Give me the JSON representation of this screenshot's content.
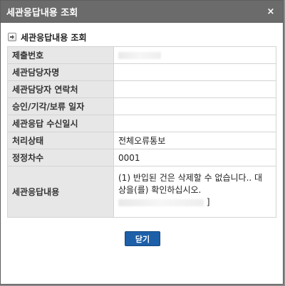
{
  "window": {
    "title": "세관응답내용 조회",
    "close_symbol": "×"
  },
  "section": {
    "title": "세관응답내용 조회",
    "icon": "arrow-right-box-icon"
  },
  "rows": [
    {
      "label": "제출번호",
      "value": ""
    },
    {
      "label": "세관담당자명",
      "value": ""
    },
    {
      "label": "세관담당자 연락처",
      "value": ""
    },
    {
      "label": "승인/기각/보류 일자",
      "value": ""
    },
    {
      "label": "세관응답 수신일시",
      "value": ""
    },
    {
      "label": "처리상태",
      "value": "전체오류통보"
    },
    {
      "label": "정정차수",
      "value": "0001"
    },
    {
      "label": "세관응답내용",
      "value_lines": [
        "(1) 반입된 건은 삭제할 수 없습니다.. 대",
        "상을(를) 확인하십시오."
      ],
      "value_tail": "]"
    }
  ],
  "buttons": {
    "close_label": "닫기"
  },
  "colors": {
    "title_bar": "#6b6b6b",
    "button": "#1d5fa8",
    "label_bg": "#e7e7e7"
  }
}
